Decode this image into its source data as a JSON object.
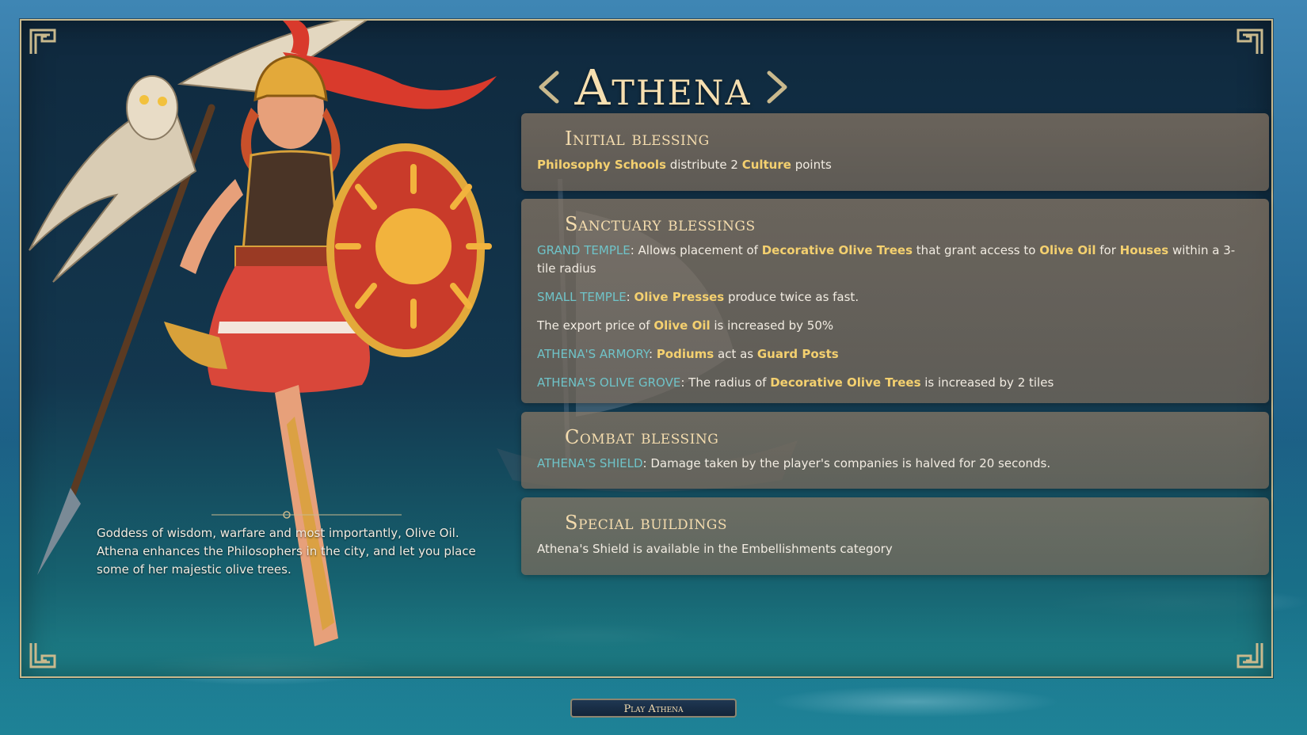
{
  "header": {
    "title": "Athena"
  },
  "description": "Goddess of wisdom, warfare and most importantly, Olive Oil. Athena enhances the Philosophers in the city, and let you place some of her majestic olive trees.",
  "panels": {
    "initial": {
      "heading": "Initial blessing",
      "line1": {
        "a": "Philosophy Schools",
        "b": " distribute 2 ",
        "c": "Culture",
        "d": " points"
      }
    },
    "sanctuary": {
      "heading": "Sanctuary blessings",
      "grand_temple": {
        "label": "GRAND TEMPLE",
        "t1": ": Allows placement of ",
        "h1": "Decorative Olive Trees",
        "t2": " that grant access to ",
        "h2": "Olive Oil",
        "t3": " for ",
        "h3": "Houses",
        "t4": " within a 3-tile radius"
      },
      "small_temple": {
        "label": "SMALL TEMPLE",
        "t1": ": ",
        "h1": "Olive Presses",
        "t2": " produce twice as fast."
      },
      "export": {
        "t1": "The export price of ",
        "h1": "Olive Oil",
        "t2": " is increased by 50%"
      },
      "armory": {
        "label": "ATHENA'S ARMORY",
        "t1": ": ",
        "h1": "Podiums",
        "t2": " act as ",
        "h2": "Guard Posts"
      },
      "grove": {
        "label": "ATHENA'S OLIVE GROVE",
        "t1": ": The radius of ",
        "h1": "Decorative Olive Trees",
        "t2": " is increased by 2 tiles"
      }
    },
    "combat": {
      "heading": "Combat blessing",
      "shield": {
        "label": "ATHENA'S SHIELD",
        "t1": ": Damage taken by the player's companies is halved for 20 seconds."
      }
    },
    "special": {
      "heading": "Special buildings",
      "line1": "Athena's Shield is available in the Embellishments category"
    }
  },
  "footer": {
    "play_label": "Play Athena"
  },
  "colors": {
    "highlight": "#f4d06f",
    "building": "#6fc3c8",
    "title": "#f6dfb0",
    "frame": "#c9b98d"
  },
  "icons": [
    "meander-corner-icon",
    "left-arrow-ornament-icon",
    "right-arrow-ornament-icon",
    "divider-ornament-icon"
  ]
}
